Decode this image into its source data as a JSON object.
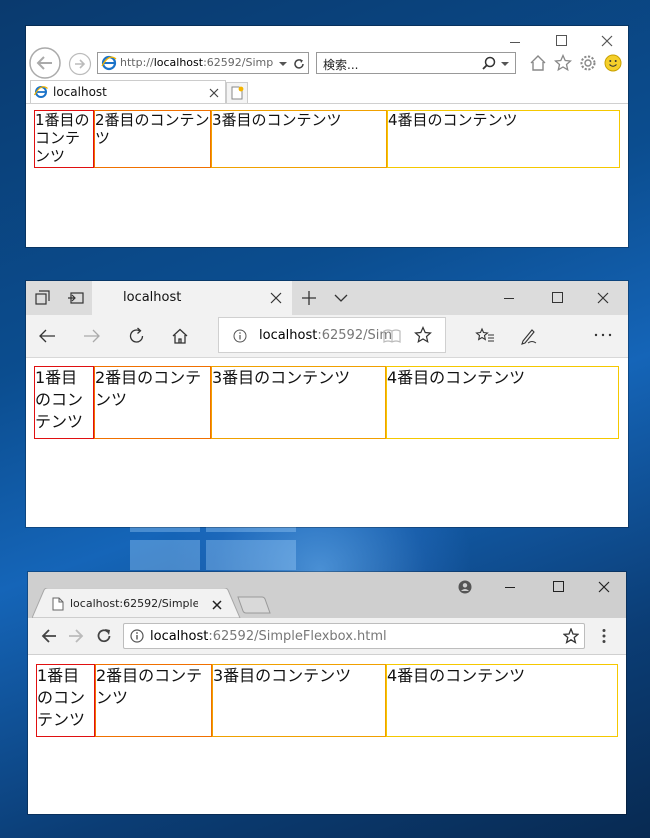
{
  "colors": {
    "c1": "#e01010",
    "c2": "#f07000",
    "c3": "#f0a000",
    "c4": "#f5c800"
  },
  "ie": {
    "url_prefix": "http://",
    "url_host": "localhost",
    "url_rest": ":62592/Simp",
    "search_placeholder": "検索...",
    "tab_title": "localhost",
    "items": [
      "1番目のコンテンツ",
      "2番目のコンテンツ",
      "3番目のコンテンツ",
      "4番目のコンテンツ"
    ]
  },
  "edge": {
    "tab_title": "localhost",
    "url_host": "localhost",
    "url_rest": ":62592/Sim",
    "items": [
      "1番目のコンテンツ",
      "2番目のコンテンツ",
      "3番目のコンテンツ",
      "4番目のコンテンツ"
    ]
  },
  "chrome": {
    "tab_title": "localhost:62592/SimpleFlex",
    "url_host": "localhost",
    "url_rest": ":62592/SimpleFlexbox.html",
    "items": [
      "1番目のコンテンツ",
      "2番目のコンテンツ",
      "3番目のコンテンツ",
      "4番目のコンテンツ"
    ]
  }
}
